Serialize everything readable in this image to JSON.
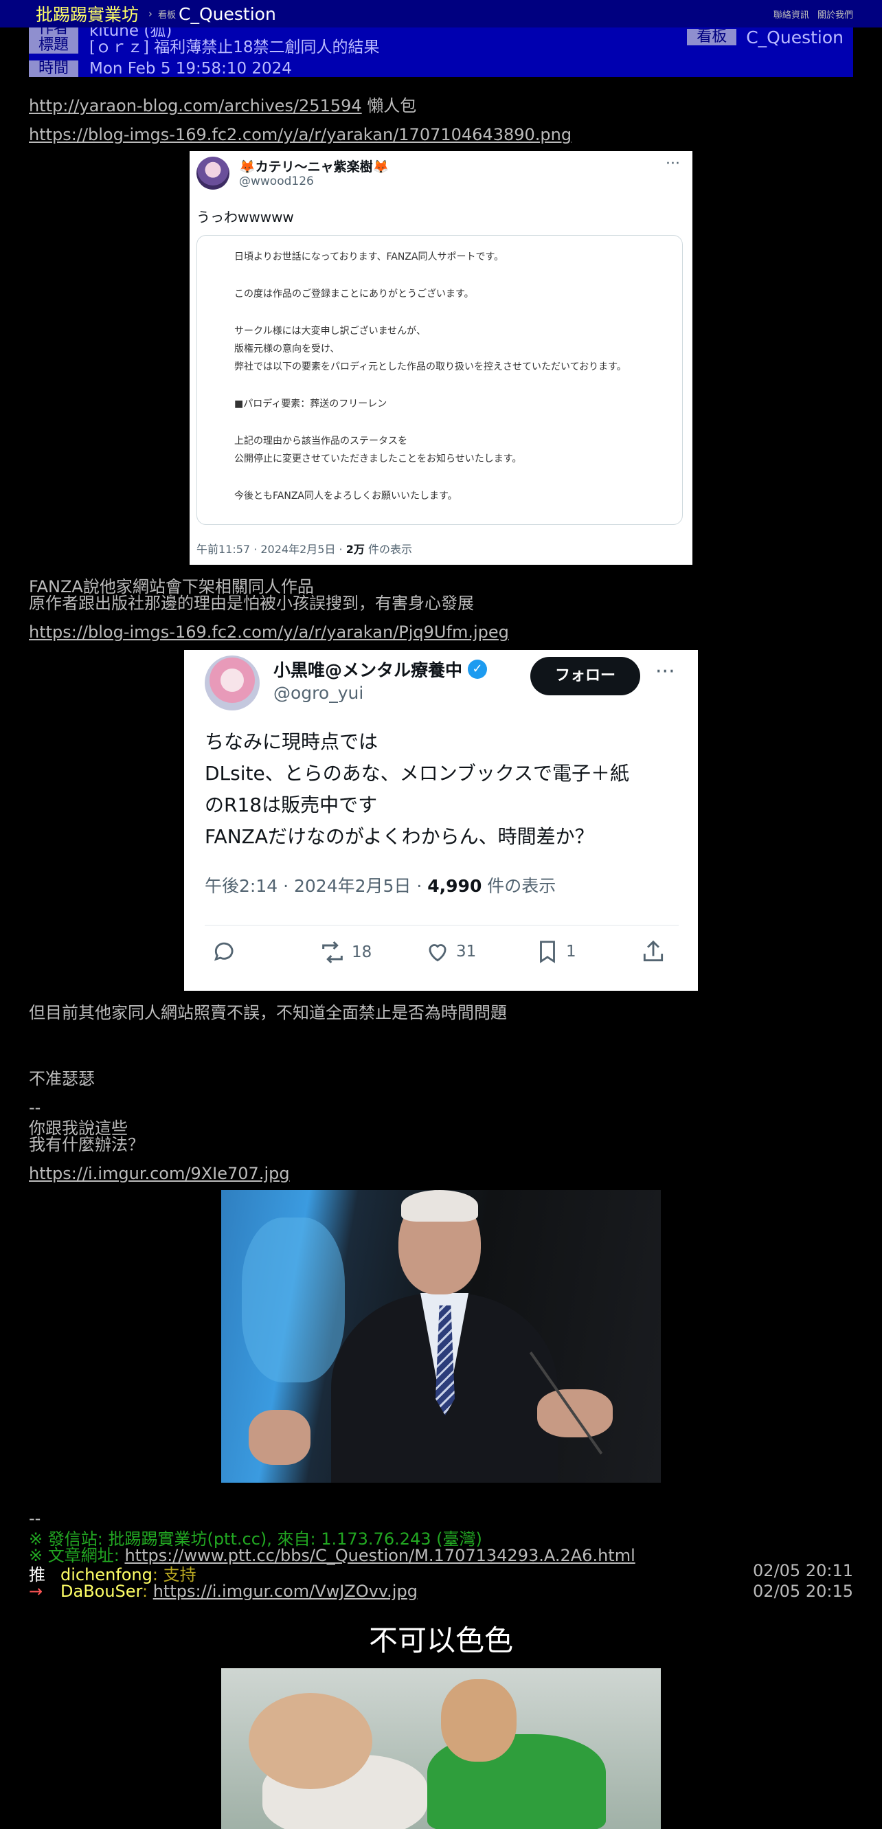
{
  "topbar": {
    "site": "批踢踢實業坊",
    "separator": "›",
    "board_label": "看板",
    "board": "C_Question",
    "contact": "聯絡資訊",
    "about": "關於我們"
  },
  "meta": {
    "author_tag": "作者",
    "author": "kitune (狐)",
    "title_tag": "標題",
    "title": "[ｏｒｚ] 福利薄禁止18禁二創同人的結果",
    "time_tag": "時間",
    "time": "Mon Feb  5 19:58:10 2024",
    "board_tag": "看板",
    "board": "C_Question"
  },
  "body": {
    "link1": "http://yaraon-blog.com/archives/251594",
    "link1_suffix": " 懶人包",
    "link2": "https://blog-imgs-169.fc2.com/y/a/r/yarakan/1707104643890.png",
    "para1_line1": "FANZA說他家網站會下架相關同人作品",
    "para1_line2": "原作者跟出版社那邊的理由是怕被小孩誤搜到，有害身心發展",
    "link3": "https://blog-imgs-169.fc2.com/y/a/r/yarakan/Pjq9Ufm.jpeg",
    "para2": "但目前其他家同人網站照賣不誤，不知道全面禁止是否為時間問題",
    "para3": "不准瑟瑟",
    "sig_sep": "--",
    "sig_line1": "你跟我說這些",
    "sig_line2": "我有什麼辦法？",
    "link4": "https://i.imgur.com/9XIe707.jpg",
    "footer_sep": "--"
  },
  "tweet1": {
    "name": "🦊カテリ〜ニャ紫楽樹🦊",
    "handle": "@wwood126",
    "more": "···",
    "text": "うっわwwwww",
    "card_lines": [
      "日頃よりお世話になっております、FANZA同人サポートです。",
      "この度は作品のご登録まことにありがとうございます。",
      "サークル様には大変申し訳ございませんが、",
      "版権元様の意向を受け、",
      "弊社では以下の要素をパロディ元とした作品の取り扱いを控えさせていただいております。",
      "■パロディ要素：葬送のフリーレン",
      "上記の理由から該当作品のステータスを",
      "公開停止に変更させていただきましたことをお知らせいたします。",
      "今後ともFANZA同人をよろしくお願いいたします。"
    ],
    "footer_time": "午前11:57 · 2024年2月5日 · ",
    "views": "2万",
    "views_suffix": " 件の表示"
  },
  "tweet2": {
    "name": "小黒唯@メンタル療養中",
    "verified": "✓",
    "handle": "@ogro_yui",
    "follow": "フォロー",
    "more": "···",
    "lines": [
      "ちなみに現時点では",
      "DLsite、とらのあな、メロンブックスで電子＋紙",
      "のR18は販売中です",
      "FANZAだけなのがよくわからん、時間差か？"
    ],
    "footer_time": "午後2:14 · 2024年2月5日 · ",
    "views": "4,990",
    "views_suffix": " 件の表示",
    "retweets": "18",
    "likes": "31",
    "bookmarks": "1"
  },
  "footer": {
    "source": "※ 發信站: 批踢踢實業坊(ptt.cc), 來自: 1.173.76.243 (臺灣)",
    "url_label": "※ 文章網址: ",
    "url": "https://www.ptt.cc/bbs/C_Question/M.1707134293.A.2A6.html"
  },
  "pushes": [
    {
      "tag": "推",
      "user": "dichenfong",
      "content": ": 支持",
      "time": "02/05 20:11"
    },
    {
      "tag": "→",
      "user": "DaBouSer",
      "content": ": ",
      "link": "https://i.imgur.com/VwJZOvv.jpg",
      "time": "02/05 20:15"
    }
  ],
  "meme": {
    "caption": "不可以色色"
  },
  "colors": {
    "background": "#000000",
    "topbar": "#000080",
    "meta": "#0000b0",
    "push_user": "#ffff66",
    "push_arrow": "#ff5555",
    "footer_green": "#22a822"
  }
}
